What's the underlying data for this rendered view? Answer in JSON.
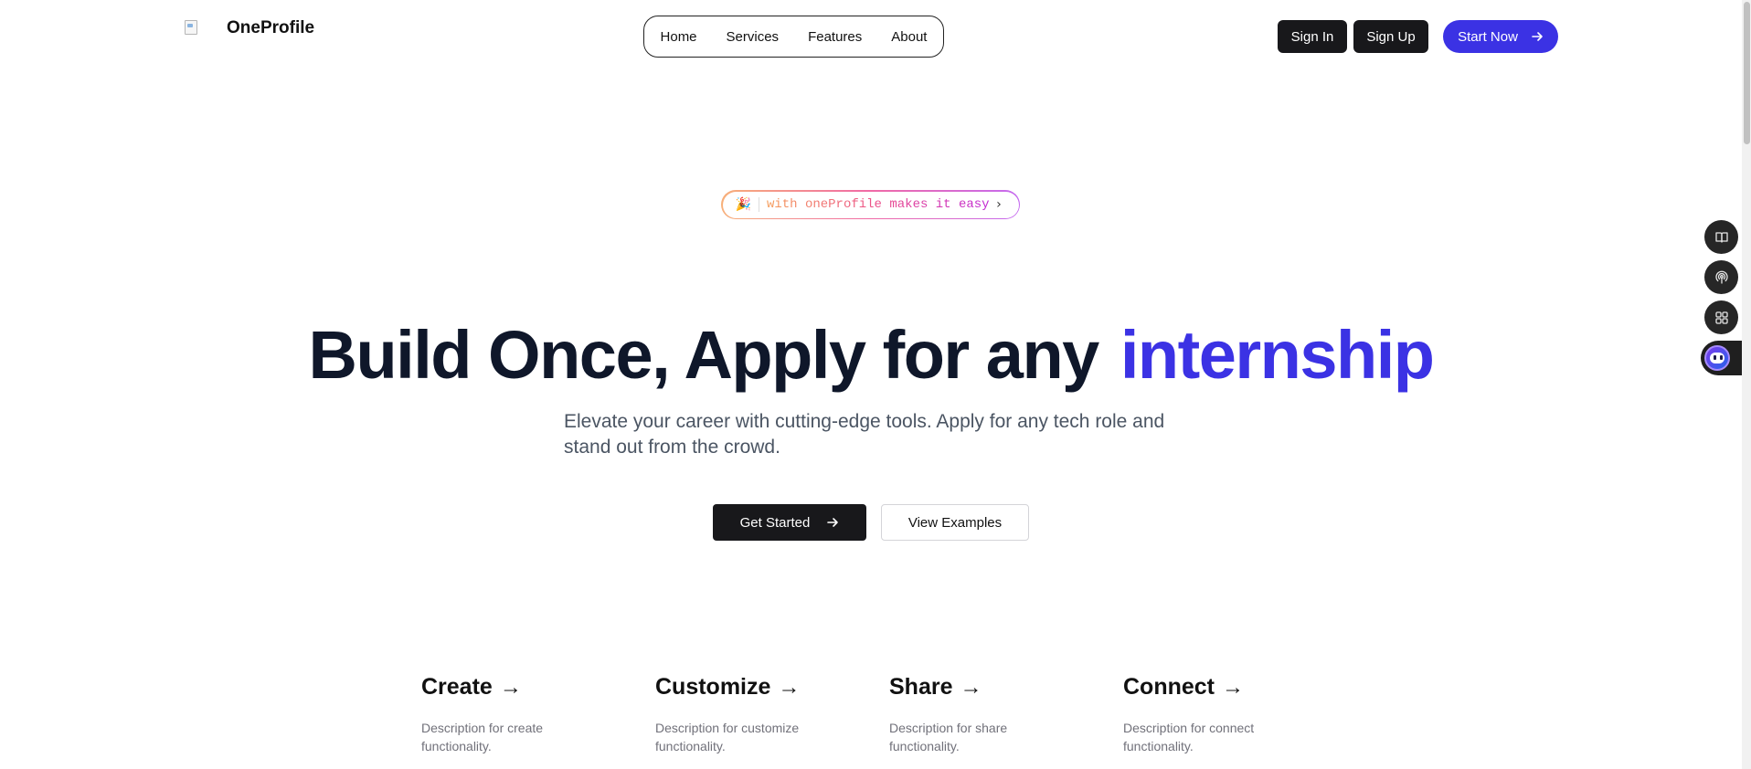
{
  "header": {
    "brand": "OneProfile",
    "nav": [
      {
        "label": "Home"
      },
      {
        "label": "Services"
      },
      {
        "label": "Features"
      },
      {
        "label": "About"
      }
    ],
    "sign_in": "Sign In",
    "sign_up": "Sign Up",
    "start_now": "Start Now"
  },
  "badge": {
    "emoji": "🎉",
    "text": "with oneProfile makes it easy",
    "chevron": "›"
  },
  "hero": {
    "title_main": "Build Once, Apply for any",
    "title_accent": "internship",
    "subtitle": "Elevate your career with cutting-edge tools. Apply for any tech role and stand out from the crowd.",
    "get_started": "Get Started",
    "view_examples": "View Examples"
  },
  "features": [
    {
      "title": "Create",
      "arrow": "→",
      "desc": "Description for create functionality."
    },
    {
      "title": "Customize",
      "arrow": "→",
      "desc": "Description for customize functionality."
    },
    {
      "title": "Share",
      "arrow": "→",
      "desc": "Description for share functionality."
    },
    {
      "title": "Connect",
      "arrow": "→",
      "desc": "Description for connect functionality."
    }
  ],
  "dock": [
    "book-icon",
    "broadcast-icon",
    "grid-icon",
    "chatbot-icon"
  ],
  "colors": {
    "accent": "#3b32e4",
    "dark_button": "#18181b",
    "heading": "#0f172a",
    "muted": "#71717a"
  }
}
